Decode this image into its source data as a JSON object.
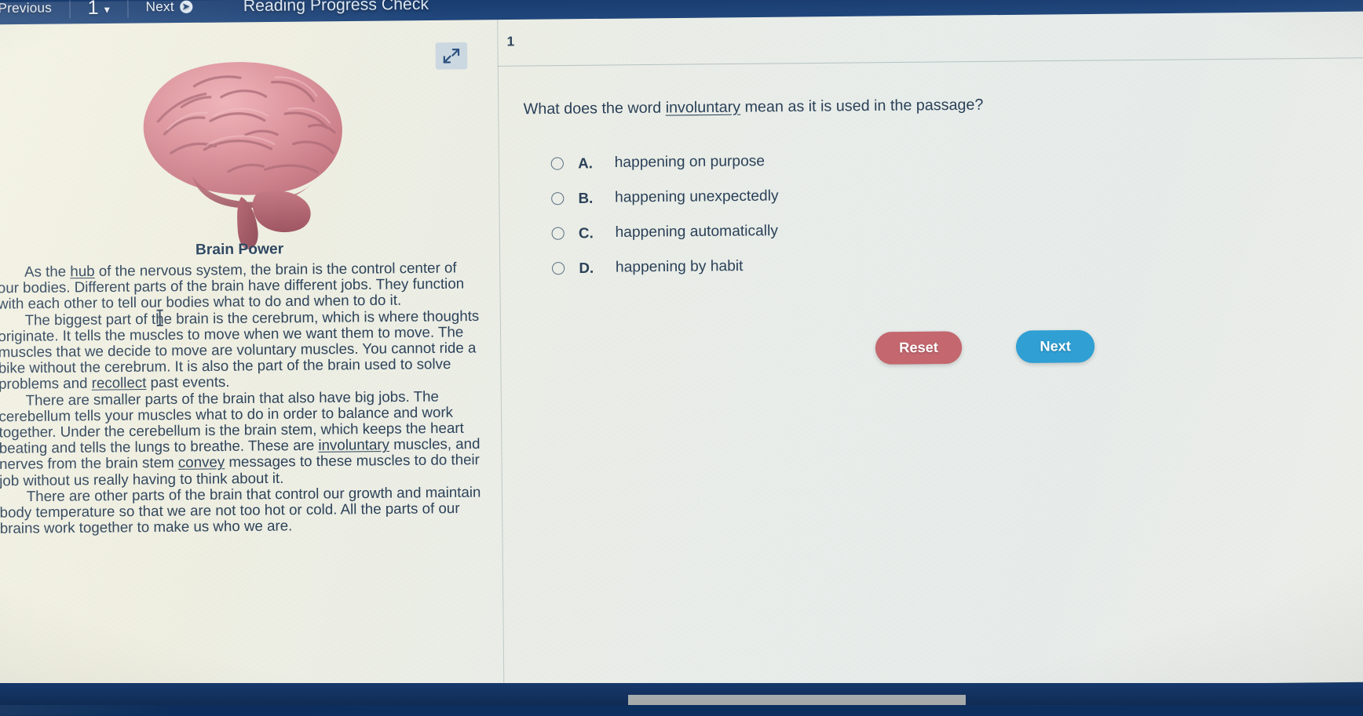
{
  "nav": {
    "previous_label": "Previous",
    "page_number": "1",
    "caret_icon": "chevron-down-icon",
    "next_label": "Next",
    "refresh_icon": "refresh-arrow-icon",
    "title": "Reading Progress Check"
  },
  "passage": {
    "expand_icon": "expand-arrows-icon",
    "image_alt": "human-brain-illustration",
    "title": "Brain Power",
    "paragraphs": [
      "As the hub of the nervous system, the brain is the control center of our bodies. Different parts of the brain have different jobs. They function with each other to tell our bodies what to do and when to do it.",
      "The biggest part of the brain is the cerebrum, which is where thoughts originate. It tells the muscles to move when we want them to move. The muscles that we decide to move are voluntary muscles. You cannot ride a bike without the cerebrum. It is also the part of the brain used to solve problems and recollect past events.",
      "There are smaller parts of the brain that also have big jobs. The cerebellum tells your muscles what to do in order to balance and work together. Under the cerebellum is the brain stem, which keeps the heart beating and tells the lungs to breathe. These are involuntary muscles, and nerves from the brain stem convey messages to these muscles to do their job without us really having to think about it.",
      "There are other parts of the brain that control our growth and maintain body temperature so that we are not too hot or cold. All the parts of our brains work together to make us who we are."
    ],
    "underlined_words": [
      "hub",
      "recollect",
      "involuntary",
      "convey"
    ]
  },
  "question": {
    "number": "1",
    "prompt_before": "What does the word ",
    "prompt_word": "involuntary",
    "prompt_after": " mean as it is used in the passage?",
    "choices": [
      {
        "letter": "A.",
        "text": "happening on purpose",
        "selected": false
      },
      {
        "letter": "B.",
        "text": "happening unexpectedly",
        "selected": false
      },
      {
        "letter": "C.",
        "text": "happening automatically",
        "selected": false
      },
      {
        "letter": "D.",
        "text": "happening by habit",
        "selected": false
      }
    ]
  },
  "actions": {
    "reset_label": "Reset",
    "next_label": "Next"
  },
  "colors": {
    "navbar": "#1b3f73",
    "reset_button": "#c4676f",
    "next_button": "#2f9fd4",
    "text": "#2a4058",
    "brain_pink": "#d98a93"
  }
}
